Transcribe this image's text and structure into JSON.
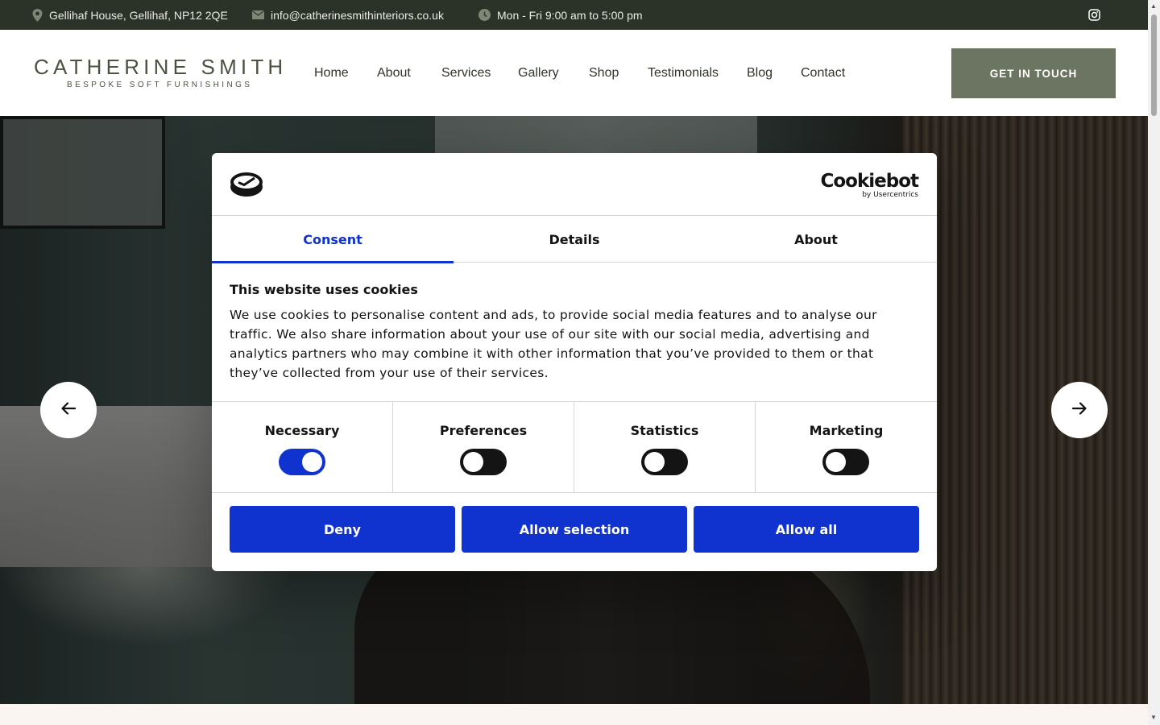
{
  "topbar": {
    "address": "Gellihaf House, Gellihaf, NP12 2QE",
    "email": "info@catherinesmithinteriors.co.uk",
    "hours": "Mon - Fri 9:00 am to 5:00 pm",
    "social_icon": "instagram-icon"
  },
  "header": {
    "logo_name": "CATHERINE SMITH",
    "logo_tagline": "BESPOKE SOFT FURNISHINGS",
    "nav": [
      "Home",
      "About",
      "Services",
      "Gallery",
      "Shop",
      "Testimonials",
      "Blog",
      "Contact"
    ],
    "cta_label": "GET IN TOUCH"
  },
  "hero": {
    "prev_icon": "arrow-left-icon",
    "next_icon": "arrow-right-icon"
  },
  "cookie_dialog": {
    "brand_name": "Cookiebot",
    "brand_sub": "by Usercentrics",
    "tabs": [
      "Consent",
      "Details",
      "About"
    ],
    "active_tab": "Consent",
    "title": "This website uses cookies",
    "body": "We use cookies to personalise content and ads, to provide social media features and to analyse our traffic. We also share information about your use of our site with our social media, advertising and analytics partners who may combine it with other information that you’ve provided to them or that they’ve collected from your use of their services.",
    "categories": [
      {
        "label": "Necessary",
        "enabled": true
      },
      {
        "label": "Preferences",
        "enabled": false
      },
      {
        "label": "Statistics",
        "enabled": false
      },
      {
        "label": "Marketing",
        "enabled": false
      }
    ],
    "buttons": {
      "deny": "Deny",
      "allow_selection": "Allow selection",
      "allow_all": "Allow all"
    }
  },
  "colors": {
    "topbar_bg": "#2b3227",
    "brand_green": "#6b7561",
    "consent_blue": "#1032cf"
  }
}
